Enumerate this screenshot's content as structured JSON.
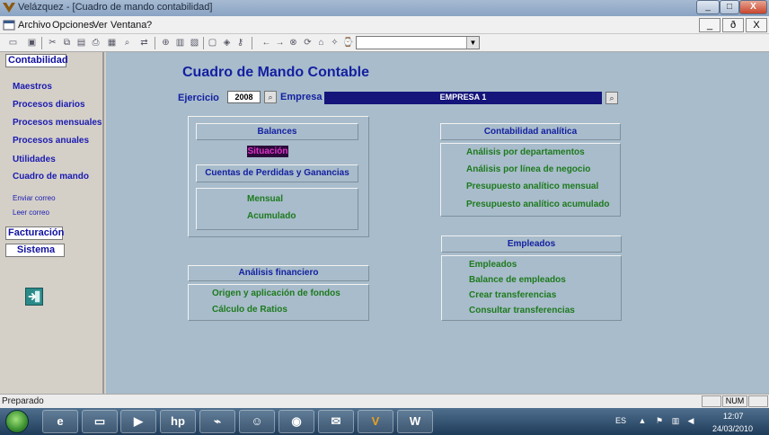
{
  "window": {
    "title": "Velázquez - [Cuadro de mando contabilidad]",
    "buttons": {
      "minimize": "_",
      "maximize": "□",
      "close": "X"
    }
  },
  "menubar": {
    "items": [
      {
        "label": "Archivo"
      },
      {
        "label": "Opciones"
      },
      {
        "label": "Ver"
      },
      {
        "label": "Ventana"
      },
      {
        "label": "?"
      }
    ],
    "mdi_buttons": {
      "minimize": "_",
      "restore": "ð",
      "close": "X"
    }
  },
  "toolbar": {
    "icons": [
      "open-icon",
      "save-icon",
      "cut-icon",
      "copy-icon",
      "paste-icon",
      "print-icon",
      "preview-icon",
      "find-icon",
      "replace-icon",
      "zoom-icon",
      "calc-icon",
      "report-icon",
      "form-icon",
      "view-icon",
      "key-icon",
      "back-icon",
      "forward-icon",
      "stop-icon",
      "refresh-icon",
      "home-icon",
      "favorites-icon",
      "history-icon"
    ],
    "combo_value": ""
  },
  "leftnav": {
    "section_contabilidad": "Contabilidad",
    "links": [
      {
        "label": "Maestros"
      },
      {
        "label": "Procesos diarios"
      },
      {
        "label": "Procesos mensuales"
      },
      {
        "label": "Procesos anuales"
      },
      {
        "label": "Utilidades"
      },
      {
        "label": "Cuadro de mando"
      }
    ],
    "small_links": [
      {
        "label": "Enviar correo"
      },
      {
        "label": "Leer correo"
      }
    ],
    "section_facturacion": "Facturación",
    "section_sistema": "Sistema"
  },
  "main": {
    "title": "Cuadro de Mando Contable",
    "ejercicio_label": "Ejercicio",
    "ejercicio_value": "2008",
    "empresa_label": "Empresa",
    "empresa_value": "EMPRESA 1",
    "balances": {
      "header": "Balances",
      "situacion": "Situación",
      "pyg_header": "Cuentas de Perdidas y Ganancias",
      "mensual": "Mensual",
      "acumulado": "Acumulado"
    },
    "analisis_financiero": {
      "header": "Análisis financiero",
      "items": [
        "Origen y aplicación de fondos",
        "Cálculo de Ratios"
      ]
    },
    "contabilidad_analitica": {
      "header": "Contabilidad analítica",
      "items": [
        "Análisis por departamentos",
        "Análisis por línea de negocio",
        "Presupuesto analítico mensual",
        "Presupuesto analítico acumulado"
      ]
    },
    "empleados": {
      "header": "Empleados",
      "items": [
        "Empleados",
        "Balance de empleados",
        "Crear transferencias",
        "Consultar transferencias"
      ]
    }
  },
  "statusbar": {
    "text": "Preparado",
    "num": "NUM"
  },
  "taskbar": {
    "apps": [
      "ie-icon",
      "folder-icon",
      "media-player-icon",
      "hp-icon",
      "monitor-icon",
      "messenger-icon",
      "firefox-icon",
      "mail-icon",
      "velazquez-icon",
      "word-icon"
    ],
    "hp_label": "hp",
    "word_label": "W",
    "language": "ES",
    "time": "12:07",
    "date": "24/03/2010"
  },
  "colors": {
    "title_blue": "#1420a0",
    "link_green": "#1d7a1d",
    "empresa_bg": "#14147a",
    "main_bg": "#a8bccb",
    "selected_fg": "#e033c8"
  }
}
